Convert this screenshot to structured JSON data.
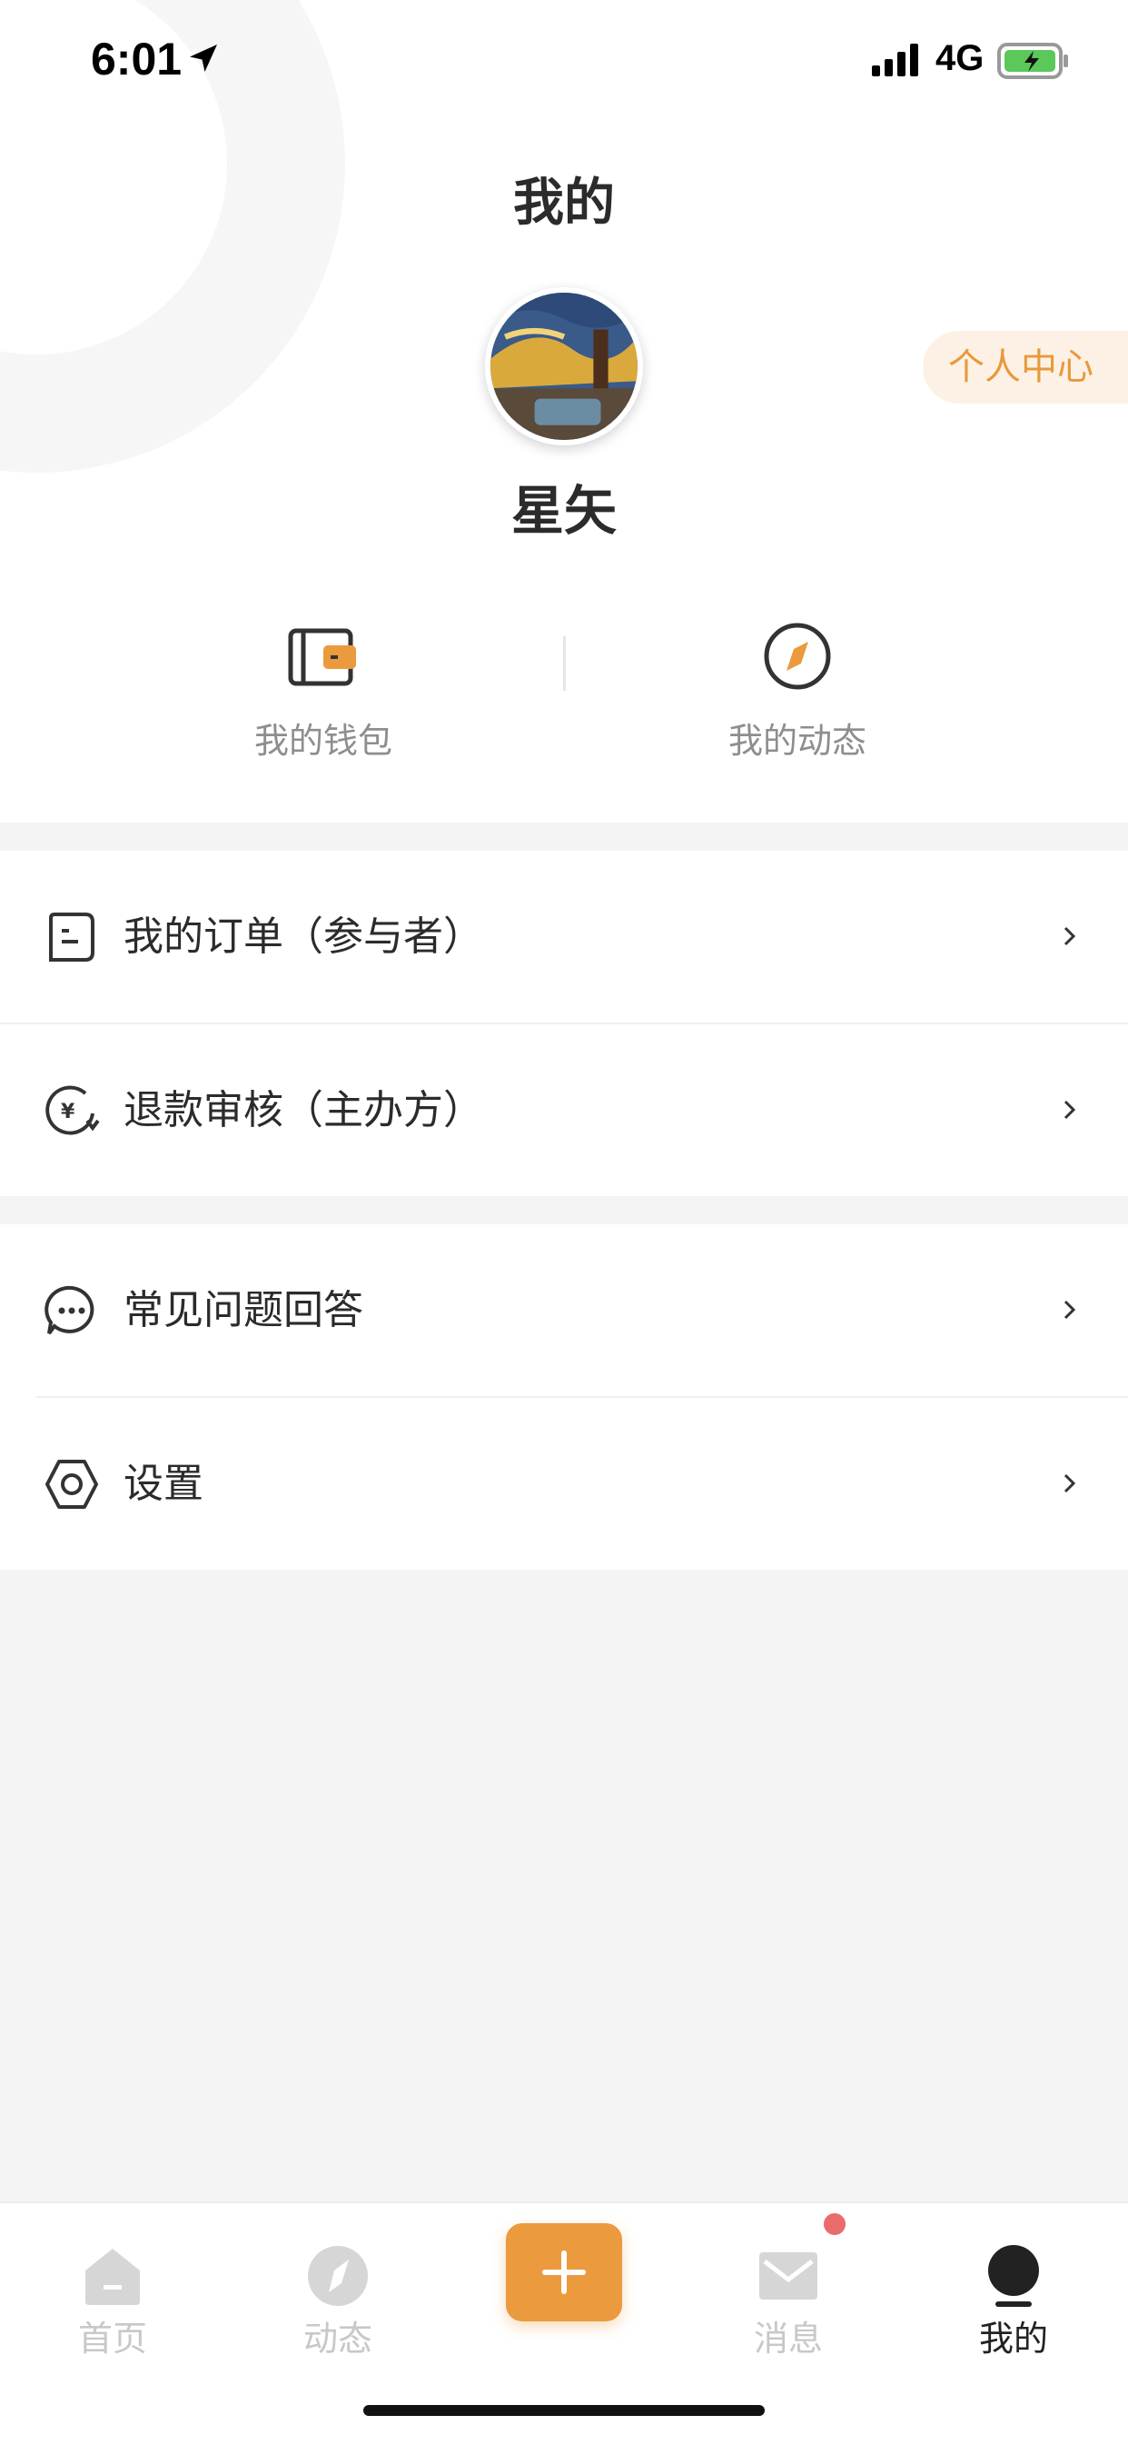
{
  "status_bar": {
    "time": "6:01",
    "network": "4G",
    "colors": {
      "battery": "#5cc85a"
    }
  },
  "header": {
    "title": "我的"
  },
  "profile": {
    "username": "星矢",
    "center_button_label": "个人中心"
  },
  "quick_actions": [
    {
      "label": "我的钱包",
      "icon": "wallet-icon"
    },
    {
      "label": "我的动态",
      "icon": "compass-icon"
    }
  ],
  "menu_groups": [
    [
      {
        "label": "我的订单（参与者）",
        "icon": "order-icon"
      },
      {
        "label": "退款审核（主办方）",
        "icon": "refund-icon"
      }
    ],
    [
      {
        "label": "常见问题回答",
        "icon": "chat-bubble-icon"
      },
      {
        "label": "设置",
        "icon": "settings-icon"
      }
    ]
  ],
  "tab_bar": {
    "tabs": [
      {
        "label": "首页",
        "icon": "home-icon",
        "active": false
      },
      {
        "label": "动态",
        "icon": "compass-icon",
        "active": false
      },
      {
        "label": "消息",
        "icon": "mail-icon",
        "active": false,
        "badge": true
      },
      {
        "label": "我的",
        "icon": "user-icon",
        "active": true
      }
    ],
    "center_icon": "plus-icon"
  },
  "colors": {
    "accent": "#eb9a3d",
    "accent_light": "#fdf1e5",
    "text_primary": "#2b2b2b",
    "text_muted": "#8e8e8e",
    "inactive": "#c8c8c8",
    "background": "#f4f4f4"
  }
}
